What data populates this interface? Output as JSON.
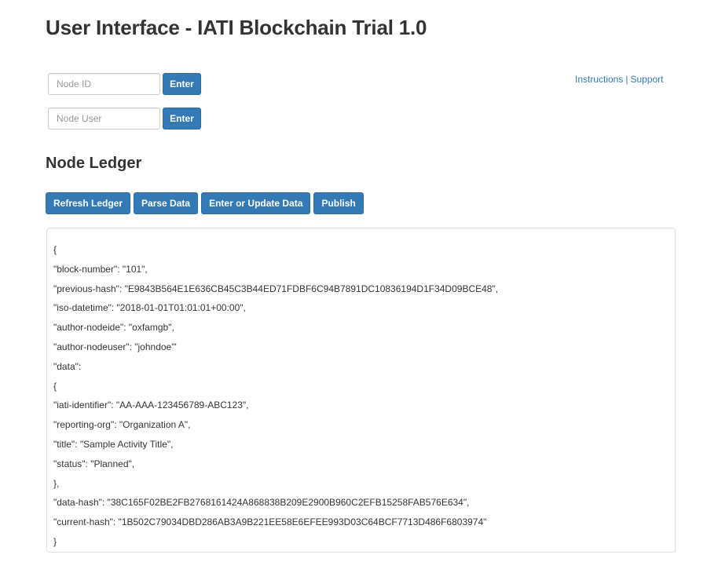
{
  "header": {
    "title": "User Interface - IATI Blockchain Trial 1.0"
  },
  "node_id": {
    "placeholder": "Node ID",
    "value": "",
    "button_label": "Enter"
  },
  "node_user": {
    "placeholder": "Node User",
    "value": "",
    "button_label": "Enter"
  },
  "links": {
    "instructions": "Instructions",
    "separator": "|",
    "support": "Support"
  },
  "ledger": {
    "title": "Node Ledger",
    "buttons": {
      "refresh": "Refresh Ledger",
      "parse": "Parse Data",
      "enter_update": "Enter or Update Data",
      "publish": "Publish"
    },
    "lines": [
      "{",
      "\"block-number\": \"101\",",
      "\"previous-hash\": \"E9843B564E1E636CB45C3B44ED71FDBF6C94B7891DC10836194D1F34D09BCE48\",",
      "\"iso-datetime\": \"2018-01-01T01:01:01+00:00\",",
      "\"author-nodeide\": \"oxfamgb\",",
      "\"author-nodeuser\": \"johndoe\"'",
      "\"data\":",
      "{",
      "\"iati-identifier\": \"AA-AAA-123456789-ABC123\",",
      "\"reporting-org\": \"Organization A\",",
      "\"title\": \"Sample Activity Title\",",
      "\"status\": \"Planned\",",
      "},",
      "\"data-hash\": \"38C165F02BE2FB2768161424A868838B209E2900B960C2EFB15258FAB576E634\",",
      "\"current-hash\": \"1B502C79034DBD286AB3A9B221EE58E6EFEE993D03C64BCF7713D486F6803974\"",
      "}"
    ]
  },
  "colors": {
    "primary": "#337ab7",
    "text": "#333333",
    "border": "#dddddd"
  }
}
